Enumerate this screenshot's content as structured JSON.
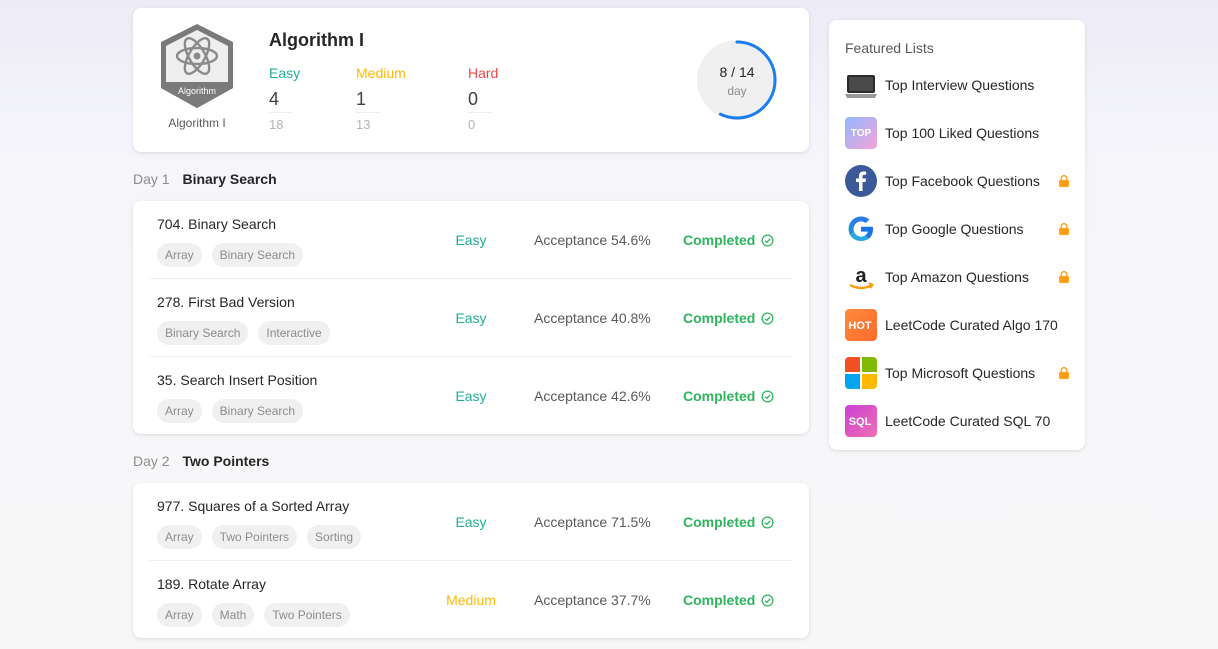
{
  "study_plan": {
    "title": "Algorithm I",
    "badge_label": "Algorithm",
    "badge_caption": "Algorithm I",
    "stats": {
      "easy": {
        "label": "Easy",
        "solved": "4",
        "total": "18"
      },
      "medium": {
        "label": "Medium",
        "solved": "1",
        "total": "13"
      },
      "hard": {
        "label": "Hard",
        "solved": "0",
        "total": "0"
      }
    },
    "progress": {
      "text": "8 / 14",
      "unit": "day",
      "completed": 8,
      "total": 14
    }
  },
  "days": [
    {
      "day": "Day 1",
      "topic": "Binary Search",
      "problems": [
        {
          "title": "704. Binary Search",
          "tags": [
            "Array",
            "Binary Search"
          ],
          "difficulty": "Easy",
          "acceptance": "Acceptance 54.6%",
          "status": "Completed"
        },
        {
          "title": "278. First Bad Version",
          "tags": [
            "Binary Search",
            "Interactive"
          ],
          "difficulty": "Easy",
          "acceptance": "Acceptance 40.8%",
          "status": "Completed"
        },
        {
          "title": "35. Search Insert Position",
          "tags": [
            "Array",
            "Binary Search"
          ],
          "difficulty": "Easy",
          "acceptance": "Acceptance 42.6%",
          "status": "Completed"
        }
      ]
    },
    {
      "day": "Day 2",
      "topic": "Two Pointers",
      "problems": [
        {
          "title": "977. Squares of a Sorted Array",
          "tags": [
            "Array",
            "Two Pointers",
            "Sorting"
          ],
          "difficulty": "Easy",
          "acceptance": "Acceptance 71.5%",
          "status": "Completed"
        },
        {
          "title": "189. Rotate Array",
          "tags": [
            "Array",
            "Math",
            "Two Pointers"
          ],
          "difficulty": "Medium",
          "acceptance": "Acceptance 37.7%",
          "status": "Completed"
        }
      ]
    }
  ],
  "featured": {
    "title": "Featured Lists",
    "items": [
      {
        "label": "Top Interview Questions",
        "icon": "laptop-icon",
        "locked": false
      },
      {
        "label": "Top 100 Liked Questions",
        "icon": "top-icon",
        "locked": false
      },
      {
        "label": "Top Facebook Questions",
        "icon": "facebook-icon",
        "locked": true
      },
      {
        "label": "Top Google Questions",
        "icon": "google-icon",
        "locked": true
      },
      {
        "label": "Top Amazon Questions",
        "icon": "amazon-icon",
        "locked": true
      },
      {
        "label": "LeetCode Curated Algo 170",
        "icon": "hot-icon",
        "locked": false
      },
      {
        "label": "Top Microsoft Questions",
        "icon": "microsoft-icon",
        "locked": true
      },
      {
        "label": "LeetCode Curated SQL 70",
        "icon": "sql-icon",
        "locked": false
      }
    ]
  },
  "colors": {
    "easy": "#1fad98",
    "medium": "#ffb800",
    "hard": "#ef4743",
    "completed": "#2db55d",
    "progress_ring": "#1a7df0",
    "lock": "#ffa116"
  }
}
